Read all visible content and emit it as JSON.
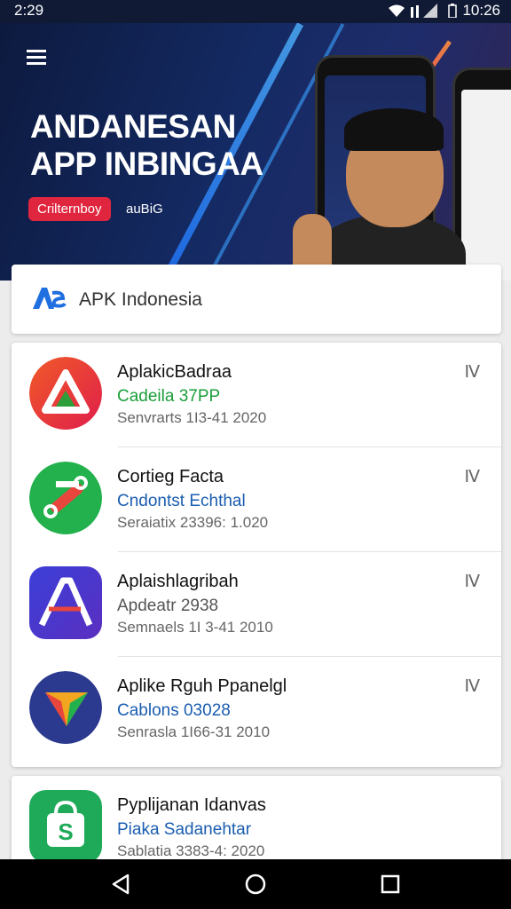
{
  "status": {
    "time": "2:29",
    "right_text": "10:26"
  },
  "hero": {
    "title_line1": "ANDANESAN",
    "title_line2": "APP INBINGAA",
    "badge": "Crilternboy",
    "badge_sub": "auBiG"
  },
  "search": {
    "label": "APK Indonesia"
  },
  "apps": [
    {
      "name": "AplakicBadraa",
      "sub": "Cadeila 37PP",
      "sub_color": "#1a9e3a",
      "date": "Senvrarts 1I3-41 2020",
      "more": "m"
    },
    {
      "name": "Cortieg Facta",
      "sub": "Cndontst Echthal",
      "sub_color": "#1a5db0",
      "date": "Seraiatix 23396: 1.020",
      "more": "m"
    },
    {
      "name": "Aplaishlagribah",
      "sub": "Apdeatr 2938",
      "sub_color": "#555555",
      "date": "Semnaels 1I 3-41 2010",
      "more": "m"
    },
    {
      "name": "Aplike Rguh Ppanelgl",
      "sub": "Cablons 03028",
      "sub_color": "#1a5db0",
      "date": "Senrasla 1I66-31 2010",
      "more": "m"
    }
  ],
  "extra_app": {
    "name": "Pyplijanan Idanvas",
    "sub": "Piaka Sadanehtar",
    "sub_color": "#1a5db0",
    "date": "Sablatia 3383-4: 2020"
  },
  "icons": [
    "menu-icon",
    "wifi-icon",
    "signal-icon",
    "battery-icon",
    "more-icon",
    "back-icon",
    "home-icon",
    "recents-icon"
  ]
}
